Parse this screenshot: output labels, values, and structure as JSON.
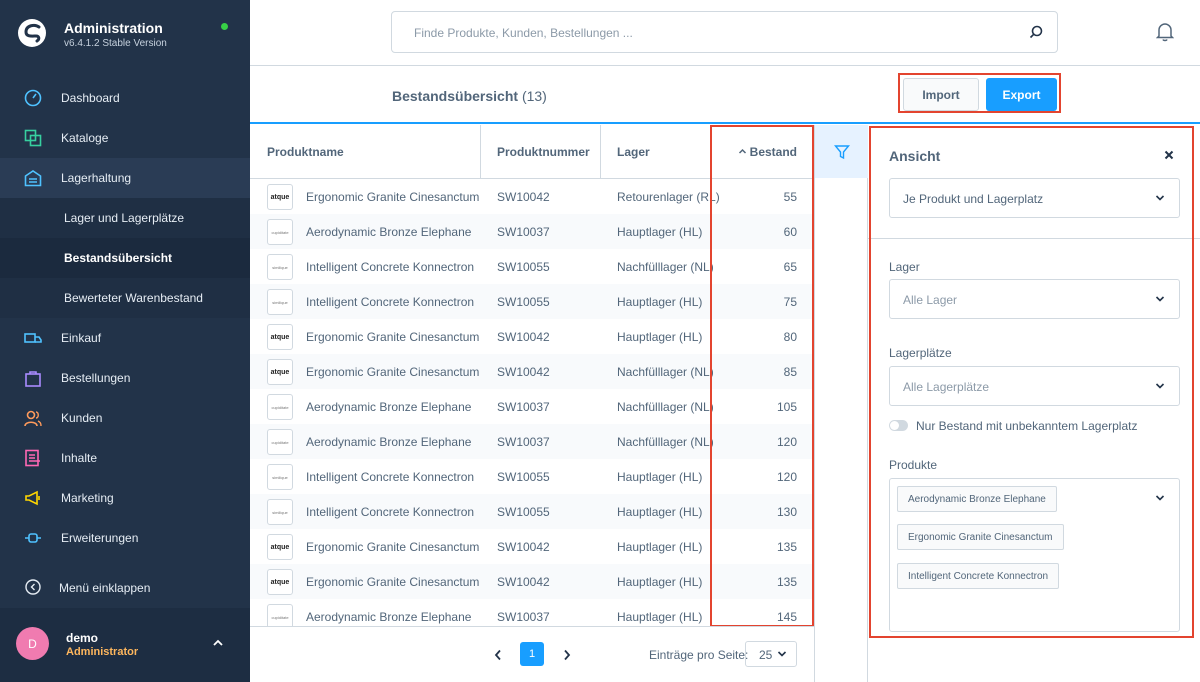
{
  "app": {
    "title": "Administration",
    "version": "v6.4.1.2 Stable Version"
  },
  "sidebar": {
    "items": [
      {
        "label": "Dashboard",
        "icon": "dashboard-icon"
      },
      {
        "label": "Kataloge",
        "icon": "catalog-icon"
      },
      {
        "label": "Lagerhaltung",
        "icon": "warehouse-icon"
      },
      {
        "label": "Lager und Lagerplätze"
      },
      {
        "label": "Bestandsübersicht"
      },
      {
        "label": "Bewerteter Warenbestand"
      },
      {
        "label": "Einkauf",
        "icon": "truck-icon"
      },
      {
        "label": "Bestellungen",
        "icon": "bag-icon"
      },
      {
        "label": "Kunden",
        "icon": "users-icon"
      },
      {
        "label": "Inhalte",
        "icon": "content-icon"
      },
      {
        "label": "Marketing",
        "icon": "megaphone-icon"
      },
      {
        "label": "Erweiterungen",
        "icon": "plug-icon"
      }
    ],
    "collapse_label": "Menü einklappen",
    "user": {
      "initial": "D",
      "name": "demo",
      "role": "Administrator"
    }
  },
  "search": {
    "placeholder": "Finde Produkte, Kunden, Bestellungen ..."
  },
  "page": {
    "title": "Bestandsübersicht",
    "count": "(13)",
    "import_label": "Import",
    "export_label": "Export"
  },
  "table": {
    "headers": [
      "Produktname",
      "Produktnummer",
      "Lager",
      "Bestand"
    ],
    "rows": [
      {
        "thumb": "atque",
        "name": "Ergonomic Granite Cinesanctum",
        "number": "SW10042",
        "warehouse": "Retourenlager (RL)",
        "stock": "55"
      },
      {
        "thumb": "cupiditate",
        "name": "Aerodynamic Bronze Elephane",
        "number": "SW10037",
        "warehouse": "Hauptlager (HL)",
        "stock": "60"
      },
      {
        "thumb": "similique",
        "name": "Intelligent Concrete Konnectron",
        "number": "SW10055",
        "warehouse": "Nachfülllager (NL)",
        "stock": "65"
      },
      {
        "thumb": "similique",
        "name": "Intelligent Concrete Konnectron",
        "number": "SW10055",
        "warehouse": "Hauptlager (HL)",
        "stock": "75"
      },
      {
        "thumb": "atque",
        "name": "Ergonomic Granite Cinesanctum",
        "number": "SW10042",
        "warehouse": "Hauptlager (HL)",
        "stock": "80"
      },
      {
        "thumb": "atque",
        "name": "Ergonomic Granite Cinesanctum",
        "number": "SW10042",
        "warehouse": "Nachfülllager (NL)",
        "stock": "85"
      },
      {
        "thumb": "cupiditate",
        "name": "Aerodynamic Bronze Elephane",
        "number": "SW10037",
        "warehouse": "Nachfülllager (NL)",
        "stock": "105"
      },
      {
        "thumb": "cupiditate",
        "name": "Aerodynamic Bronze Elephane",
        "number": "SW10037",
        "warehouse": "Nachfülllager (NL)",
        "stock": "120"
      },
      {
        "thumb": "similique",
        "name": "Intelligent Concrete Konnectron",
        "number": "SW10055",
        "warehouse": "Hauptlager (HL)",
        "stock": "120"
      },
      {
        "thumb": "similique",
        "name": "Intelligent Concrete Konnectron",
        "number": "SW10055",
        "warehouse": "Hauptlager (HL)",
        "stock": "130"
      },
      {
        "thumb": "atque",
        "name": "Ergonomic Granite Cinesanctum",
        "number": "SW10042",
        "warehouse": "Hauptlager (HL)",
        "stock": "135"
      },
      {
        "thumb": "atque",
        "name": "Ergonomic Granite Cinesanctum",
        "number": "SW10042",
        "warehouse": "Hauptlager (HL)",
        "stock": "135"
      },
      {
        "thumb": "cupiditate",
        "name": "Aerodynamic Bronze Elephane",
        "number": "SW10037",
        "warehouse": "Hauptlager (HL)",
        "stock": "145"
      }
    ]
  },
  "pagination": {
    "page": "1",
    "per_page_label": "Einträge pro Seite:",
    "per_page": "25"
  },
  "filter": {
    "title": "Ansicht",
    "view_value": "Je Produkt und Lagerplatz",
    "lager_label": "Lager",
    "lager_placeholder": "Alle Lager",
    "lagerplaetze_label": "Lagerplätze",
    "lagerplaetze_placeholder": "Alle Lagerplätze",
    "toggle_label": "Nur Bestand mit unbekanntem Lagerplatz",
    "produkte_label": "Produkte",
    "produkte_tags": [
      "Aerodynamic Bronze Elephane",
      "Ergonomic Granite Cinesanctum",
      "Intelligent Concrete Konnectron"
    ]
  },
  "colors": {
    "accent": "#189eff",
    "sidebar": "#223349",
    "highlight": "#e3442f"
  }
}
